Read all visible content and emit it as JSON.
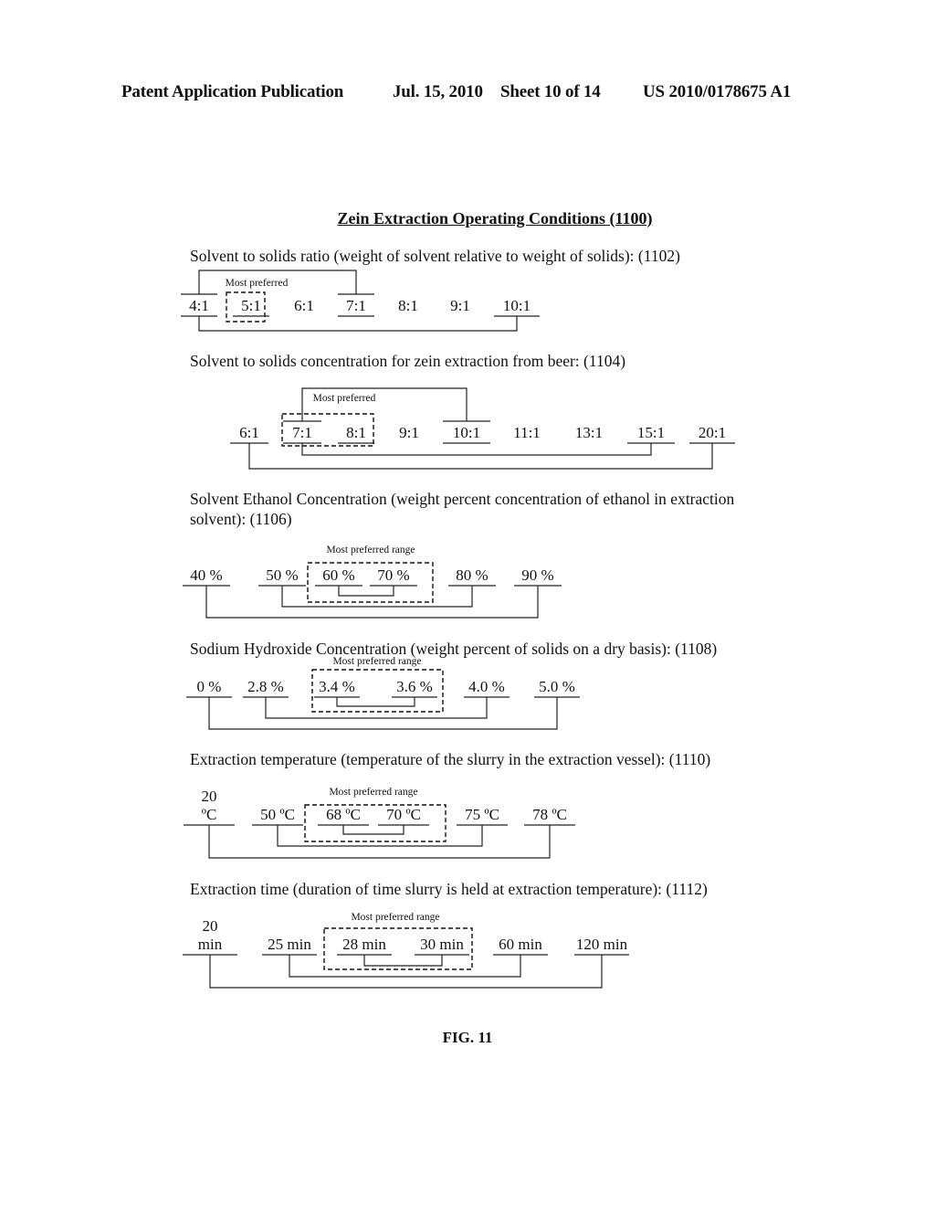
{
  "header": {
    "publication": "Patent Application Publication",
    "date": "Jul. 15, 2010",
    "sheet": "Sheet 10 of 14",
    "number": "US 2010/0178675 A1"
  },
  "title": "Zein Extraction Operating Conditions (1100)",
  "figure_label": "FIG. 11",
  "sections": [
    {
      "id": "1102",
      "title": "Solvent to solids ratio (weight of solvent relative to weight of solids):  (1102)",
      "values": [
        "4:1",
        "5:1",
        "6:1",
        "7:1",
        "8:1",
        "9:1",
        "10:1"
      ],
      "most_preferred_label": "Most preferred",
      "most_preferred": [
        "5:1"
      ],
      "ranges": [
        {
          "from": "4:1",
          "to": "7:1",
          "side": "top"
        },
        {
          "from": "4:1",
          "to": "10:1",
          "side": "bottom"
        }
      ]
    },
    {
      "id": "1104",
      "title": "Solvent to solids concentration for zein extraction from beer: (1104)",
      "values": [
        "6:1",
        "7:1",
        "8:1",
        "9:1",
        "10:1",
        "11:1",
        "13:1",
        "15:1",
        "20:1"
      ],
      "most_preferred_label": "Most preferred",
      "most_preferred": [
        "7:1",
        "8:1"
      ],
      "ranges": [
        {
          "from": "7:1",
          "to": "10:1",
          "side": "top"
        },
        {
          "from": "7:1",
          "to": "15:1",
          "side": "bottom"
        },
        {
          "from": "6:1",
          "to": "20:1",
          "side": "bottom"
        }
      ]
    },
    {
      "id": "1106",
      "title": "Solvent Ethanol Concentration (weight percent concentration of ethanol in extraction solvent): (1106)",
      "values": [
        "40 %",
        "50 %",
        "60 %",
        "70 %",
        "80 %",
        "90 %"
      ],
      "most_preferred_label": "Most preferred range",
      "most_preferred": [
        "60 %",
        "70 %"
      ],
      "ranges": [
        {
          "from": "60 %",
          "to": "70 %",
          "side": "bottom"
        },
        {
          "from": "50 %",
          "to": "80 %",
          "side": "bottom"
        },
        {
          "from": "40 %",
          "to": "90 %",
          "side": "bottom"
        }
      ]
    },
    {
      "id": "1108",
      "title": "Sodium Hydroxide Concentration (weight percent of solids on a dry basis): (1108)",
      "values": [
        "0 %",
        "2.8 %",
        "3.4 %",
        "3.6 %",
        "4.0 %",
        "5.0 %"
      ],
      "most_preferred_label": "Most preferred range",
      "most_preferred": [
        "3.4 %",
        "3.6 %"
      ],
      "ranges": [
        {
          "from": "3.4 %",
          "to": "3.6 %",
          "side": "bottom"
        },
        {
          "from": "2.8 %",
          "to": "4.0 %",
          "side": "bottom"
        },
        {
          "from": "0 %",
          "to": "5.0 %",
          "side": "bottom"
        }
      ]
    },
    {
      "id": "1110",
      "title": "Extraction temperature (temperature of the slurry in the extraction vessel): (1110)",
      "values": [
        "20 ºC",
        "50 ºC",
        "68 ºC",
        "70 ºC",
        "75 ºC",
        "78 ºC"
      ],
      "most_preferred_label": "Most preferred range",
      "most_preferred": [
        "68 ºC",
        "70 ºC"
      ],
      "ranges": [
        {
          "from": "68 ºC",
          "to": "70 ºC",
          "side": "bottom"
        },
        {
          "from": "50 ºC",
          "to": "75 ºC",
          "side": "bottom"
        },
        {
          "from": "20 ºC",
          "to": "78 ºC",
          "side": "bottom"
        }
      ]
    },
    {
      "id": "1112",
      "title": "Extraction time (duration of time slurry is held at extraction temperature): (1112)",
      "values": [
        "20 min",
        "25 min",
        "28 min",
        "30 min",
        "60 min",
        "120 min"
      ],
      "most_preferred_label": "Most preferred range",
      "most_preferred": [
        "28 min",
        "30 min"
      ],
      "ranges": [
        {
          "from": "28 min",
          "to": "30 min",
          "side": "bottom"
        },
        {
          "from": "25 min",
          "to": "60 min",
          "side": "bottom"
        },
        {
          "from": "20 min",
          "to": "120 min",
          "side": "bottom"
        }
      ]
    }
  ]
}
